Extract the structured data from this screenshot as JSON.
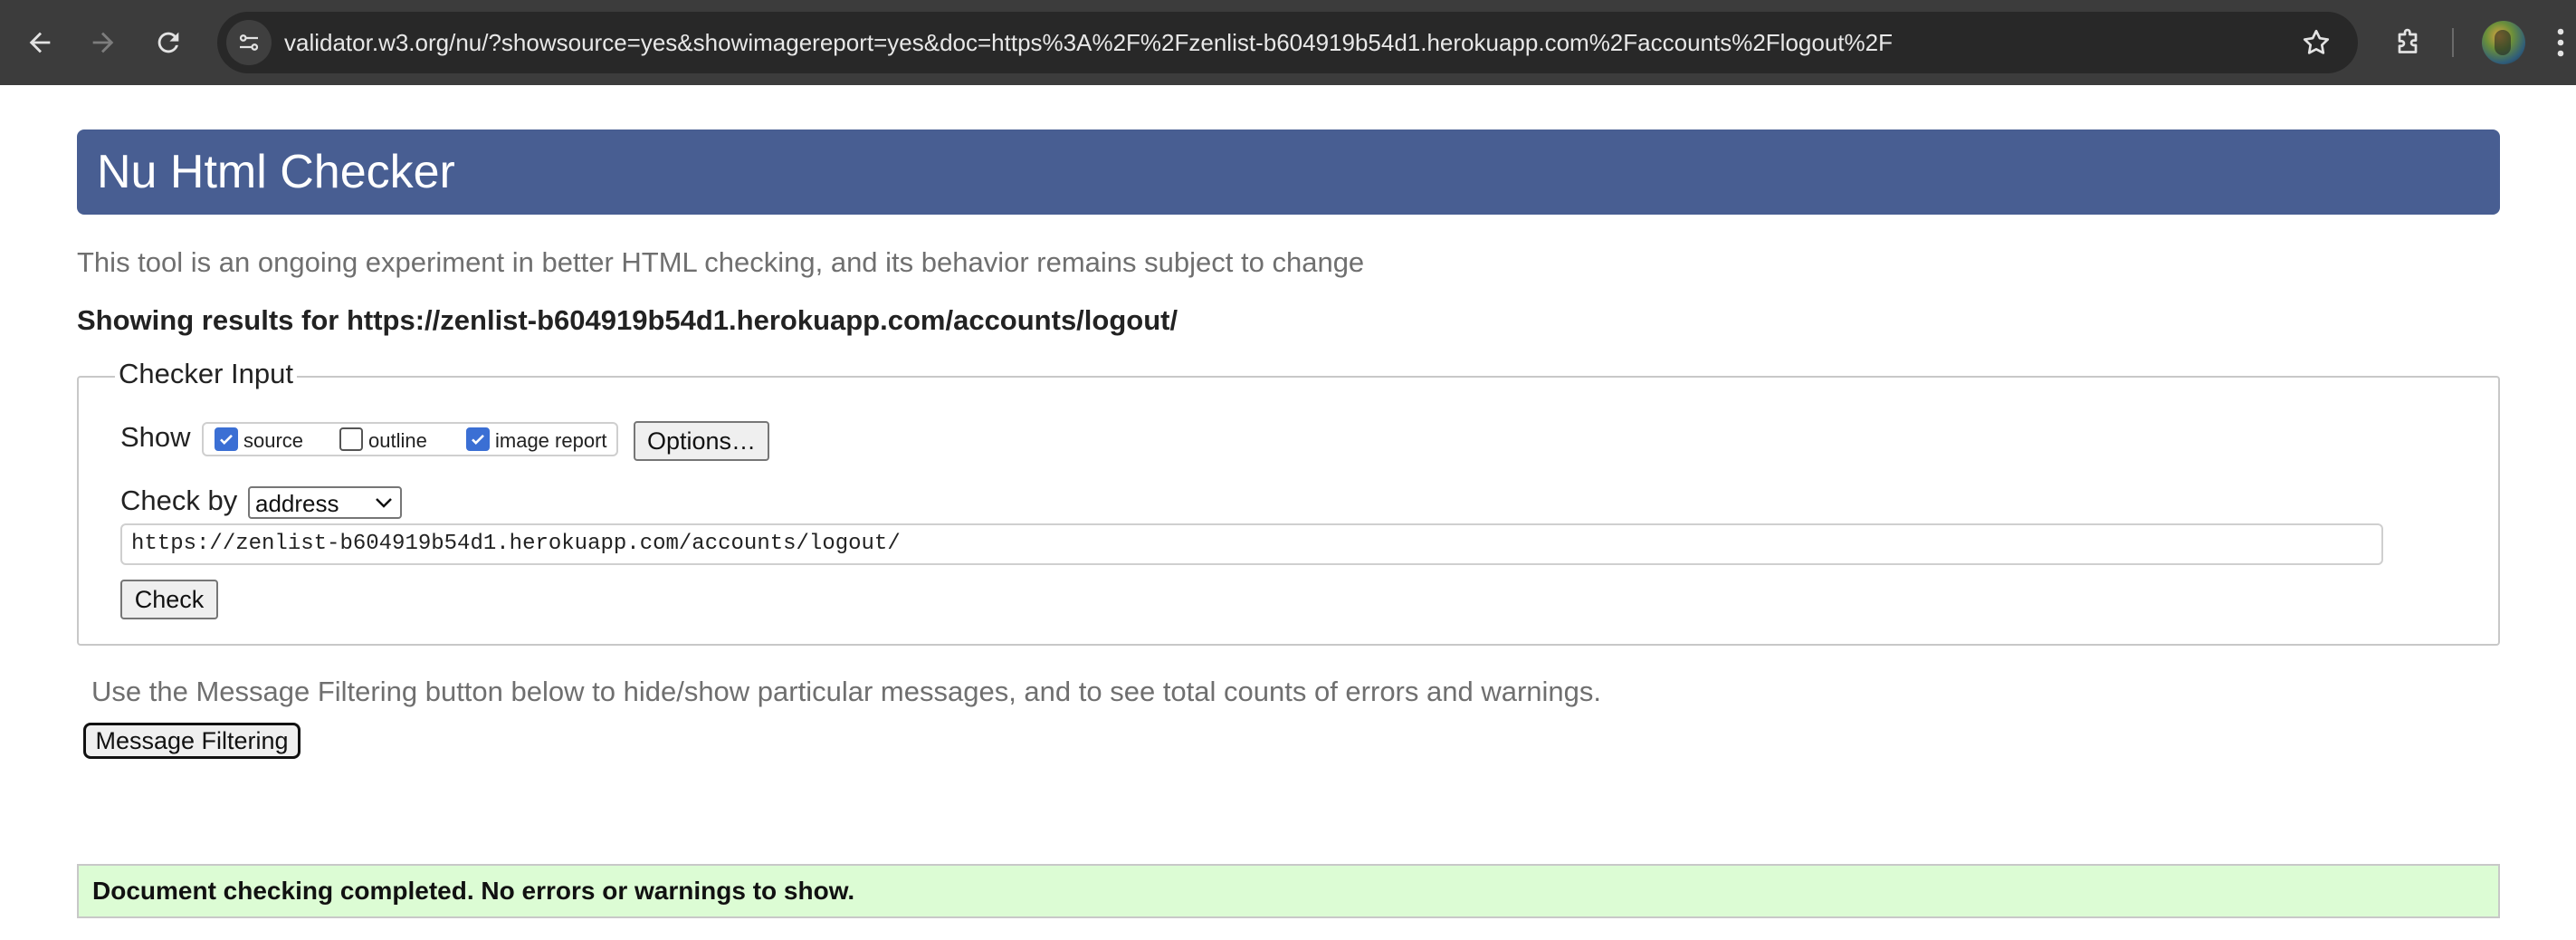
{
  "browser": {
    "url": "validator.w3.org/nu/?showsource=yes&showimagereport=yes&doc=https%3A%2F%2Fzenlist-b604919b54d1.herokuapp.com%2Faccounts%2Flogout%2F",
    "icons": [
      "back-icon",
      "forward-icon",
      "reload-icon",
      "site-info-icon",
      "star-icon",
      "extensions-icon",
      "profile-avatar",
      "menu-icon"
    ]
  },
  "page": {
    "title": "Nu Html Checker",
    "intro": "This tool is an ongoing experiment in better HTML checking, and its behavior remains subject to change",
    "results_for": "Showing results for https://zenlist-b604919b54d1.herokuapp.com/accounts/logout/"
  },
  "checker_input": {
    "legend": "Checker Input",
    "show_label": "Show",
    "show_options": [
      {
        "label": "source",
        "checked": true
      },
      {
        "label": "outline",
        "checked": false
      },
      {
        "label": "image report",
        "checked": true
      }
    ],
    "options_button": "Options…",
    "check_by_label": "Check by",
    "check_by_value": "address",
    "address_value": "https://zenlist-b604919b54d1.herokuapp.com/accounts/logout/",
    "check_button": "Check"
  },
  "filtering": {
    "hint": "Use the Message Filtering button below to hide/show particular messages, and to see total counts of errors and warnings.",
    "button": "Message Filtering"
  },
  "result": {
    "message": "Document checking completed. No errors or warnings to show."
  },
  "colors": {
    "header_bg": "#485e92",
    "success_bg": "#dcfcd4",
    "chrome_bg": "#3c3c3c",
    "checkbox_checked": "#3b6fd4"
  }
}
